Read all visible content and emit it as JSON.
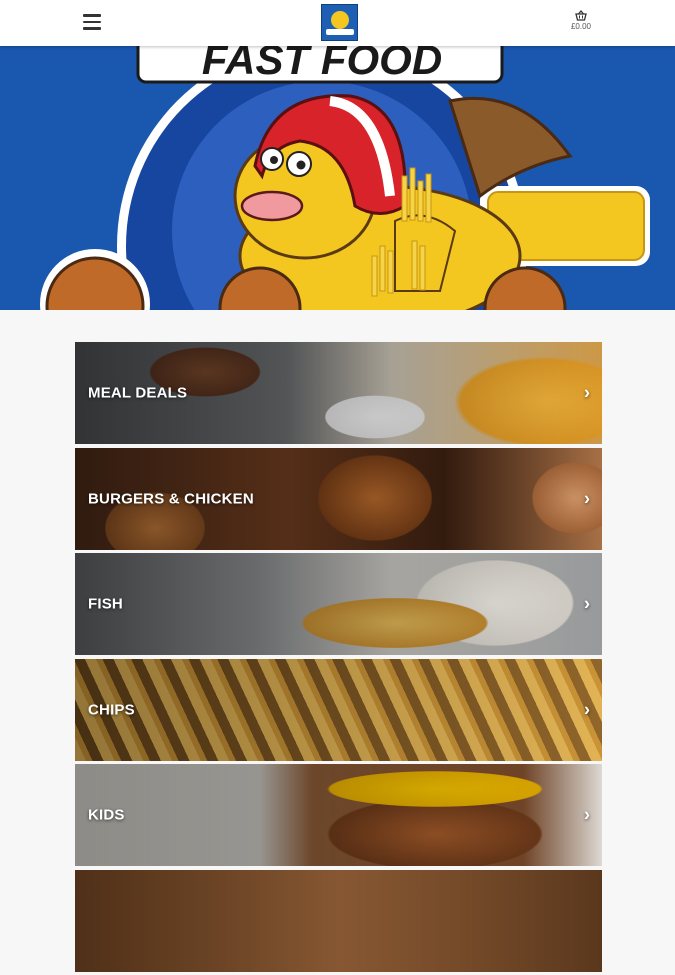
{
  "header": {
    "menu_icon": "hamburger-menu-icon",
    "logo_icon": "brand-logo-icon",
    "basket_icon": "basket-icon",
    "basket_total": "£0.00"
  },
  "hero": {
    "banner_text": "FAST FOOD",
    "colors": {
      "background": "#1a57ae",
      "helmet": "#d8232a",
      "fish": "#f4c620"
    }
  },
  "categories": [
    {
      "label": "MEAL DEALS"
    },
    {
      "label": "BURGERS & CHICKEN"
    },
    {
      "label": "FISH"
    },
    {
      "label": "CHIPS"
    },
    {
      "label": "KIDS"
    }
  ],
  "chevron_icon": "chevron-right-icon"
}
